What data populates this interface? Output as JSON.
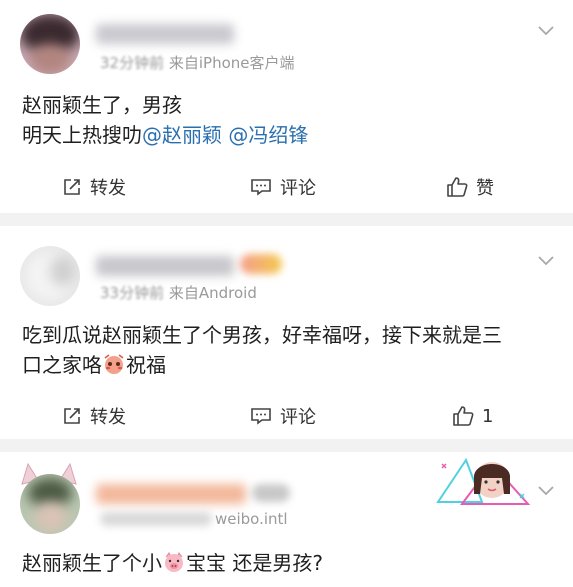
{
  "posts": [
    {
      "meta": {
        "time": "32分钟前",
        "source": "来自iPhone客户端"
      },
      "lines": [
        {
          "text": "赵丽颖生了，男孩"
        },
        {
          "text": "明天上热搜叻",
          "mention1": "@赵丽颖",
          "mention2": "@冯绍锋"
        }
      ],
      "actions": {
        "repost": "转发",
        "comment": "评论",
        "like": "赞"
      }
    },
    {
      "meta": {
        "time": "33分钟前",
        "source": "来自Android"
      },
      "lines": [
        {
          "text": "吃到瓜说赵丽颖生了个男孩，好幸福呀，接下来就是三"
        },
        {
          "text": "口之家咯",
          "text2": "祝福"
        }
      ],
      "actions": {
        "repost": "转发",
        "comment": "评论",
        "like": "1"
      }
    },
    {
      "meta": {
        "source": "weibo.intl"
      },
      "lines": [
        {
          "text": "赵丽颖生了个小",
          "text2": "宝宝  还是男孩?"
        }
      ]
    }
  ],
  "colors": {
    "mention": "#2a6fb0",
    "meta": "#9a9a9a",
    "divider": "#f2f2f2"
  },
  "icons": [
    "chevron-down-icon",
    "repost-icon",
    "comment-icon",
    "like-icon",
    "pig-emoji-icon",
    "blushing-emoji-icon"
  ]
}
